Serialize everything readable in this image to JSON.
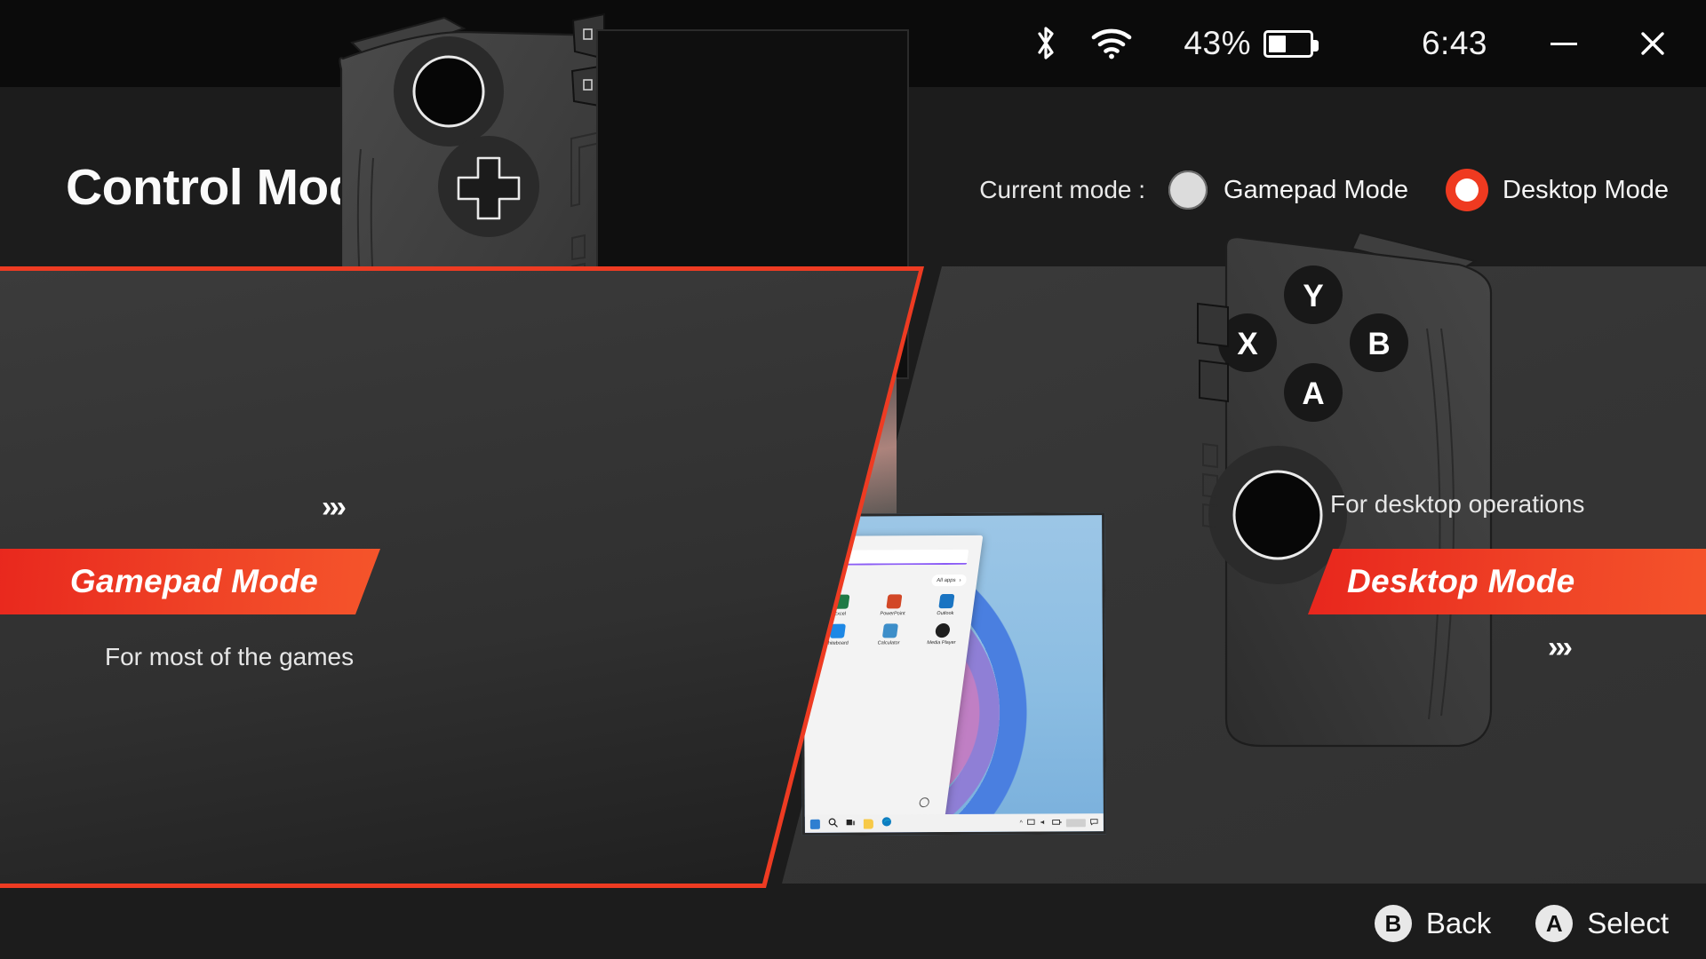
{
  "titlebar": {
    "bluetooth_icon": "bluetooth-icon",
    "wifi_icon": "wifi-icon",
    "battery_percent": "43%",
    "battery_level": 43,
    "battery_icon": "battery-icon",
    "time": "6:43",
    "minimize_label": "minimize",
    "close_label": "close"
  },
  "header": {
    "title": "Control Mode",
    "current_mode_label": "Current mode :",
    "options": [
      {
        "label": "Gamepad Mode",
        "selected": false
      },
      {
        "label": "Desktop Mode",
        "selected": true
      }
    ]
  },
  "panels": {
    "gamepad": {
      "banner_label": "Gamepad Mode",
      "caption": "For most of the games",
      "chevrons": "›››",
      "selected": true
    },
    "desktop": {
      "banner_label": "Desktop Mode",
      "caption": "For desktop operations",
      "chevrons": "›››",
      "selected": false
    }
  },
  "gamepad_left": {
    "stick_name": "left-analog-stick",
    "dpad_name": "d-pad",
    "buttons": [
      "view-button",
      "menu-button"
    ]
  },
  "gamepad_right": {
    "face_buttons": [
      "Y",
      "X",
      "B",
      "A"
    ],
    "stick_name": "right-analog-stick"
  },
  "windows_preview": {
    "all_apps_label": "All apps",
    "all_apps_chevron": "›",
    "apps": [
      {
        "name": "Excel",
        "color": "#1f7a46"
      },
      {
        "name": "PowerPoint",
        "color": "#d24726"
      },
      {
        "name": "Outlook",
        "color": "#1a74c2"
      },
      {
        "name": "Whiteboard",
        "color": "#1e88e5"
      },
      {
        "name": "Calculator",
        "color": "#3d8ec9"
      },
      {
        "name": "Media Player",
        "color": "#1f1f1f"
      }
    ],
    "taskbar_icons": [
      "start-icon",
      "search-icon",
      "task-view-icon",
      "file-explorer-icon",
      "edge-icon"
    ],
    "tray_icons": [
      "chevron-up-icon",
      "network-icon",
      "volume-icon",
      "battery-icon",
      "notification-icon"
    ],
    "power_icon": "power-icon"
  },
  "footer": {
    "buttons": [
      {
        "glyph": "B",
        "label": "Back"
      },
      {
        "glyph": "A",
        "label": "Select"
      }
    ]
  },
  "colors": {
    "accent_red": "#ef3a20",
    "banner_gradient_start": "#e8261d",
    "banner_gradient_end": "#f5552b",
    "panel_dark": "#2f2f2f",
    "panel_light": "#3a3a3a",
    "titlebar": "#0b0b0b",
    "background": "#1c1c1c"
  }
}
